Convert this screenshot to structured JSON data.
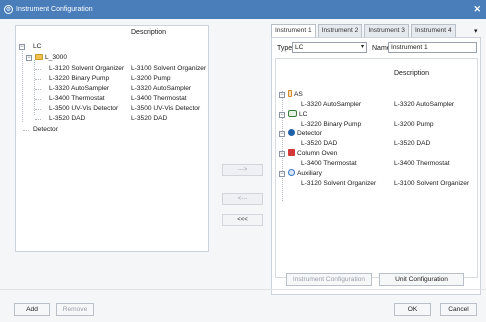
{
  "window": {
    "title": "Instrument Configuration"
  },
  "left_tree": {
    "description_header": "Description",
    "rows": [
      {
        "name": "LC",
        "description": ""
      },
      {
        "name": "L_3000",
        "description": ""
      },
      {
        "name": "L-3120 Solvent Organizer",
        "description": "L-3100 Solvent Organizer"
      },
      {
        "name": "L-3220 Binary Pump",
        "description": "L-3200 Pump"
      },
      {
        "name": "L-3320 AutoSampler",
        "description": "L-3320 AutoSampler"
      },
      {
        "name": "L-3400 Thermostat",
        "description": "L-3400 Thermostat"
      },
      {
        "name": "L-3500 UV-Vis Detector",
        "description": "L-3500 UV-Vis Detector"
      },
      {
        "name": "L-3520 DAD",
        "description": "L-3520 DAD"
      },
      {
        "name": "Detector",
        "description": ""
      }
    ]
  },
  "middle_buttons": {
    "add_arrow": "--->",
    "remove_arrow": "<---",
    "remove_all": "<<<"
  },
  "tabs": [
    "Instrument 1",
    "Instrument 2",
    "Instrument 3",
    "Instrument 4"
  ],
  "form": {
    "type_label": "Type",
    "type_value": "LC",
    "name_label": "Name",
    "name_value": "Instrument 1"
  },
  "right_tree": {
    "description_header": "Description",
    "groups": [
      {
        "name": "AS",
        "icon": "autosampler-icon",
        "child": "L-3320 AutoSampler",
        "child_desc": "L-3320 AutoSampler"
      },
      {
        "name": "LC",
        "icon": "pump-icon",
        "child": "L-3220 Binary Pump",
        "child_desc": "L-3200 Pump"
      },
      {
        "name": "Detector",
        "icon": "detector-icon",
        "child": "L-3520 DAD",
        "child_desc": "L-3520 DAD"
      },
      {
        "name": "Column Oven",
        "icon": "oven-icon",
        "child": "L-3400 Thermostat",
        "child_desc": "L-3400 Thermostat"
      },
      {
        "name": "Auxiliary",
        "icon": "auxiliary-icon",
        "child": "L-3120 Solvent Organizer",
        "child_desc": "L-3100 Solvent Organizer"
      }
    ]
  },
  "buttons": {
    "instrument_configuration": "Instrument Configuration",
    "unit_configuration": "Unit Configuration",
    "add": "Add",
    "remove": "Remove",
    "ok": "OK",
    "cancel": "Cancel"
  },
  "colors": {
    "titlebar": "#4a7ebb",
    "folder": "#f2c14e"
  }
}
